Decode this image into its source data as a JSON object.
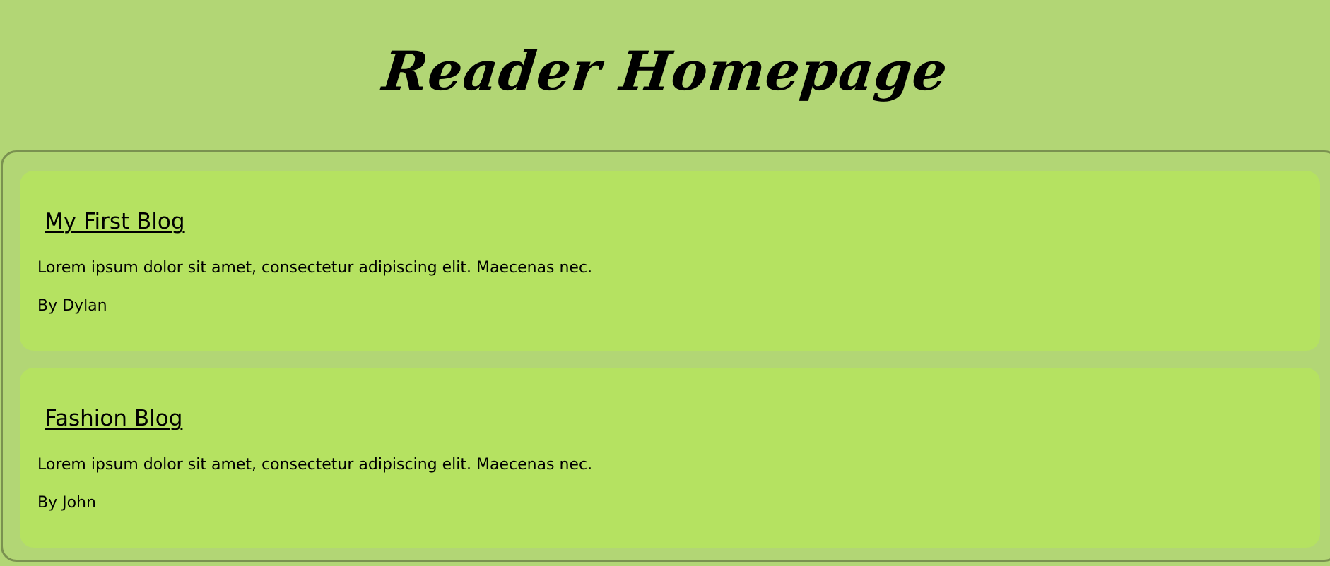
{
  "header": {
    "title": "Reader Homepage"
  },
  "blogs": [
    {
      "title": "My First Blog",
      "excerpt": "Lorem ipsum dolor sit amet, consectetur adipiscing elit. Maecenas nec.",
      "author": "By Dylan"
    },
    {
      "title": "Fashion Blog",
      "excerpt": "Lorem ipsum dolor sit amet, consectetur adipiscing elit. Maecenas nec.",
      "author": "By John"
    }
  ],
  "colors": {
    "page_background": "#b2d675",
    "card_background": "#b5e261",
    "panel_border": "#7a9150",
    "text": "#000000"
  }
}
